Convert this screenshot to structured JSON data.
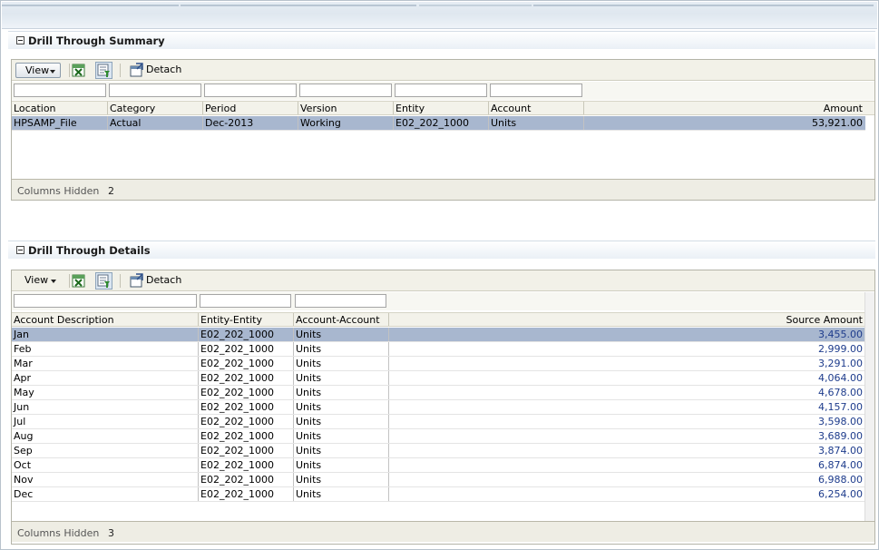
{
  "summary": {
    "title": "Drill Through Summary",
    "view_label": "View",
    "detach_label": "Detach",
    "columns": [
      "Location",
      "Category",
      "Period",
      "Version",
      "Entity",
      "Account",
      "Amount"
    ],
    "rows": [
      [
        "HPSAMP_File",
        "Actual",
        "Dec-2013",
        "Working",
        "E02_202_1000",
        "Units",
        "53,921.00"
      ]
    ],
    "footer_label": "Columns Hidden",
    "footer_value": "2"
  },
  "details": {
    "title": "Drill Through Details",
    "view_label": "View",
    "detach_label": "Detach",
    "columns": [
      "Account Description",
      "Entity-Entity",
      "Account-Account",
      "Source Amount"
    ],
    "rows": [
      [
        "Jan",
        "E02_202_1000",
        "Units",
        "3,455.00"
      ],
      [
        "Feb",
        "E02_202_1000",
        "Units",
        "2,999.00"
      ],
      [
        "Mar",
        "E02_202_1000",
        "Units",
        "3,291.00"
      ],
      [
        "Apr",
        "E02_202_1000",
        "Units",
        "4,064.00"
      ],
      [
        "May",
        "E02_202_1000",
        "Units",
        "4,678.00"
      ],
      [
        "Jun",
        "E02_202_1000",
        "Units",
        "4,157.00"
      ],
      [
        "Jul",
        "E02_202_1000",
        "Units",
        "3,598.00"
      ],
      [
        "Aug",
        "E02_202_1000",
        "Units",
        "3,689.00"
      ],
      [
        "Sep",
        "E02_202_1000",
        "Units",
        "3,874.00"
      ],
      [
        "Oct",
        "E02_202_1000",
        "Units",
        "6,874.00"
      ],
      [
        "Nov",
        "E02_202_1000",
        "Units",
        "6,988.00"
      ],
      [
        "Dec",
        "E02_202_1000",
        "Units",
        "6,254.00"
      ]
    ],
    "footer_label": "Columns Hidden",
    "footer_value": "3"
  },
  "colors": {
    "selected_row": "#a8b7cf",
    "amount_text": "#1e3c8c",
    "toolbar_bg": "#f2f1e8"
  },
  "icons": {
    "collapse": "collapse-toggle-icon",
    "export": "export-excel-icon",
    "query_by_example": "query-by-example-icon",
    "detach": "detach-icon"
  }
}
